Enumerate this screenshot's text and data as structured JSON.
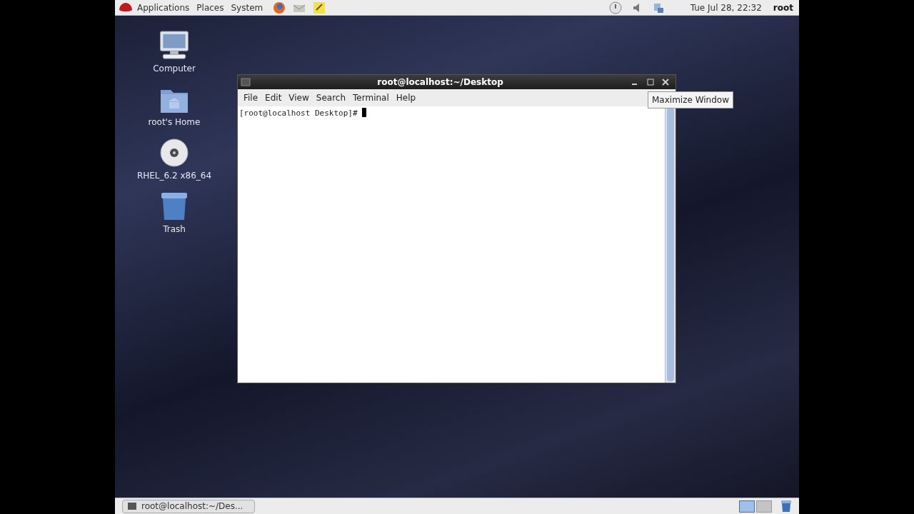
{
  "top_panel": {
    "menus": [
      "Applications",
      "Places",
      "System"
    ],
    "clock": "Tue Jul 28, 22:32",
    "user": "root"
  },
  "desktop_icons": [
    {
      "kind": "computer",
      "label": "Computer"
    },
    {
      "kind": "home",
      "label": "root's Home"
    },
    {
      "kind": "disc",
      "label": "RHEL_6.2 x86_64"
    },
    {
      "kind": "trash",
      "label": "Trash"
    }
  ],
  "terminal": {
    "title": "root@localhost:~/Desktop",
    "menus": [
      "File",
      "Edit",
      "View",
      "Search",
      "Terminal",
      "Help"
    ],
    "prompt": "[root@localhost Desktop]# "
  },
  "tooltip": "Maximize Window",
  "taskbar": {
    "tasks": [
      {
        "label": "root@localhost:~/Des...",
        "selected": false
      }
    ],
    "workspaces": [
      {
        "selected": true
      },
      {
        "selected": false
      }
    ]
  }
}
